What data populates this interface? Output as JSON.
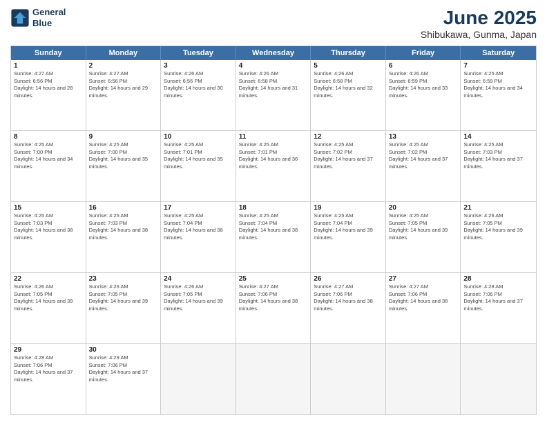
{
  "logo": {
    "line1": "General",
    "line2": "Blue"
  },
  "title": "June 2025",
  "location": "Shibukawa, Gunma, Japan",
  "weekdays": [
    "Sunday",
    "Monday",
    "Tuesday",
    "Wednesday",
    "Thursday",
    "Friday",
    "Saturday"
  ],
  "weeks": [
    [
      {
        "day": "1",
        "sunrise": "4:27 AM",
        "sunset": "6:56 PM",
        "daylight": "14 hours and 28 minutes."
      },
      {
        "day": "2",
        "sunrise": "4:27 AM",
        "sunset": "6:56 PM",
        "daylight": "14 hours and 29 minutes."
      },
      {
        "day": "3",
        "sunrise": "4:26 AM",
        "sunset": "6:56 PM",
        "daylight": "14 hours and 30 minutes."
      },
      {
        "day": "4",
        "sunrise": "4:26 AM",
        "sunset": "6:58 PM",
        "daylight": "14 hours and 31 minutes."
      },
      {
        "day": "5",
        "sunrise": "4:26 AM",
        "sunset": "6:58 PM",
        "daylight": "14 hours and 32 minutes."
      },
      {
        "day": "6",
        "sunrise": "4:26 AM",
        "sunset": "6:59 PM",
        "daylight": "14 hours and 33 minutes."
      },
      {
        "day": "7",
        "sunrise": "4:25 AM",
        "sunset": "6:59 PM",
        "daylight": "14 hours and 34 minutes."
      }
    ],
    [
      {
        "day": "8",
        "sunrise": "4:25 AM",
        "sunset": "7:00 PM",
        "daylight": "14 hours and 34 minutes."
      },
      {
        "day": "9",
        "sunrise": "4:25 AM",
        "sunset": "7:00 PM",
        "daylight": "14 hours and 35 minutes."
      },
      {
        "day": "10",
        "sunrise": "4:25 AM",
        "sunset": "7:01 PM",
        "daylight": "14 hours and 35 minutes."
      },
      {
        "day": "11",
        "sunrise": "4:25 AM",
        "sunset": "7:01 PM",
        "daylight": "14 hours and 36 minutes."
      },
      {
        "day": "12",
        "sunrise": "4:25 AM",
        "sunset": "7:02 PM",
        "daylight": "14 hours and 37 minutes."
      },
      {
        "day": "13",
        "sunrise": "4:25 AM",
        "sunset": "7:02 PM",
        "daylight": "14 hours and 37 minutes."
      },
      {
        "day": "14",
        "sunrise": "4:25 AM",
        "sunset": "7:03 PM",
        "daylight": "14 hours and 37 minutes."
      }
    ],
    [
      {
        "day": "15",
        "sunrise": "4:25 AM",
        "sunset": "7:03 PM",
        "daylight": "14 hours and 38 minutes."
      },
      {
        "day": "16",
        "sunrise": "4:25 AM",
        "sunset": "7:03 PM",
        "daylight": "14 hours and 38 minutes."
      },
      {
        "day": "17",
        "sunrise": "4:25 AM",
        "sunset": "7:04 PM",
        "daylight": "14 hours and 38 minutes."
      },
      {
        "day": "18",
        "sunrise": "4:25 AM",
        "sunset": "7:04 PM",
        "daylight": "14 hours and 38 minutes."
      },
      {
        "day": "19",
        "sunrise": "4:25 AM",
        "sunset": "7:04 PM",
        "daylight": "14 hours and 39 minutes."
      },
      {
        "day": "20",
        "sunrise": "4:25 AM",
        "sunset": "7:05 PM",
        "daylight": "14 hours and 39 minutes."
      },
      {
        "day": "21",
        "sunrise": "4:26 AM",
        "sunset": "7:05 PM",
        "daylight": "14 hours and 39 minutes."
      }
    ],
    [
      {
        "day": "22",
        "sunrise": "4:26 AM",
        "sunset": "7:05 PM",
        "daylight": "14 hours and 39 minutes."
      },
      {
        "day": "23",
        "sunrise": "4:26 AM",
        "sunset": "7:05 PM",
        "daylight": "14 hours and 39 minutes."
      },
      {
        "day": "24",
        "sunrise": "4:26 AM",
        "sunset": "7:05 PM",
        "daylight": "14 hours and 39 minutes."
      },
      {
        "day": "25",
        "sunrise": "4:27 AM",
        "sunset": "7:06 PM",
        "daylight": "14 hours and 38 minutes."
      },
      {
        "day": "26",
        "sunrise": "4:27 AM",
        "sunset": "7:06 PM",
        "daylight": "14 hours and 38 minutes."
      },
      {
        "day": "27",
        "sunrise": "4:27 AM",
        "sunset": "7:06 PM",
        "daylight": "14 hours and 38 minutes."
      },
      {
        "day": "28",
        "sunrise": "4:28 AM",
        "sunset": "7:06 PM",
        "daylight": "14 hours and 37 minutes."
      }
    ],
    [
      {
        "day": "29",
        "sunrise": "4:28 AM",
        "sunset": "7:06 PM",
        "daylight": "14 hours and 37 minutes."
      },
      {
        "day": "30",
        "sunrise": "4:29 AM",
        "sunset": "7:06 PM",
        "daylight": "14 hours and 37 minutes."
      },
      {
        "day": "",
        "sunrise": "",
        "sunset": "",
        "daylight": ""
      },
      {
        "day": "",
        "sunrise": "",
        "sunset": "",
        "daylight": ""
      },
      {
        "day": "",
        "sunrise": "",
        "sunset": "",
        "daylight": ""
      },
      {
        "day": "",
        "sunrise": "",
        "sunset": "",
        "daylight": ""
      },
      {
        "day": "",
        "sunrise": "",
        "sunset": "",
        "daylight": ""
      }
    ]
  ]
}
